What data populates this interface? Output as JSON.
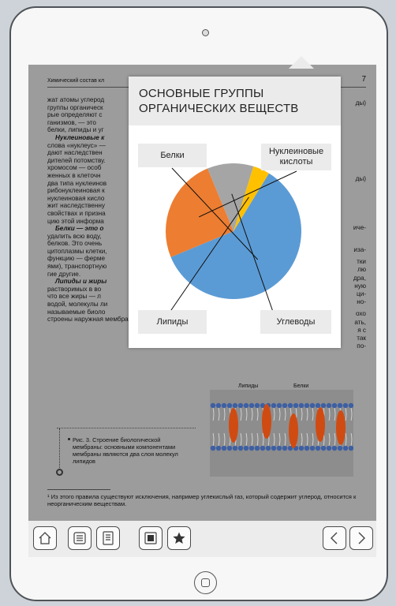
{
  "page": {
    "header_title": "Химический состав кл",
    "page_number": "7",
    "body_lines": [
      "жат атомы углерод",
      "группы органическ",
      "рые определяют с",
      "ганизмов, — это",
      "белки, липиды и уг",
      "Нуклеиновые к",
      "слова «нуклеус» —",
      "дают наследствен",
      "дителей потомству.",
      "хромосом — особ",
      "женных в клеточн",
      "два типа нуклеинов",
      "рибонуклеиновая к",
      "нуклеиновая кисло",
      "жит наследственну",
      "свойствах и призна",
      "цию этой информа",
      "Белки — это о",
      "удалить всю воду,",
      "белков. Это очень",
      "цитоплазмы клетки,",
      "функцию — ферме",
      "ями), транспортную",
      "гие другие.",
      "Липиды и жиры",
      "растворимых в во",
      "что все жиры — л",
      "водой, молекулы ли",
      "называемые биоло",
      "строены наружная мембрана клетки, оболочка ядра и ряд внутриклеточных орга-"
    ],
    "right_fragments": [
      "ды)",
      "ды)",
      "иче-",
      "иза-",
      "тки",
      "лю",
      "дра,",
      "ную",
      "ци-",
      "но-",
      "охо",
      "ать,",
      "я с",
      "так",
      "по-"
    ],
    "figure_labels": {
      "lipids": "Липиды",
      "proteins": "Белки"
    },
    "caption": "Рис. 3. Строение биологической мембраны: основными компонентами мембраны являются два слоя молекул липидов",
    "footnote": "¹ Из этого правила существуют исключения, например углекислый газ, который содержит углерод, относится к неорганическим веществам."
  },
  "popup": {
    "title_line1": "ОСНОВНЫЕ ГРУППЫ",
    "title_line2": "ОРГАНИЧЕСКИХ ВЕЩЕСТВ"
  },
  "chart_data": {
    "type": "pie",
    "title": "ОСНОВНЫЕ ГРУППЫ ОРГАНИЧЕСКИХ ВЕЩЕСТВ",
    "slices": [
      {
        "label": "Белки",
        "value": 60,
        "color": "#5b9bd5"
      },
      {
        "label": "Нуклеиновые кислоты",
        "value": 25,
        "color": "#ed7d31"
      },
      {
        "label": "Углеводы",
        "value": 11,
        "color": "#a5a5a5"
      },
      {
        "label": "Липиды",
        "value": 4,
        "color": "#ffc000"
      }
    ]
  },
  "toolbar": {
    "buttons": [
      "home-icon",
      "list-icon",
      "document-icon",
      "bookmark-icon",
      "star-icon",
      "chevron-left-icon",
      "chevron-right-icon"
    ]
  },
  "colors": {
    "screen_bg": "#9c9c9c",
    "toolbar_bg": "#ececec",
    "popup_header_bg": "#ebebeb"
  }
}
